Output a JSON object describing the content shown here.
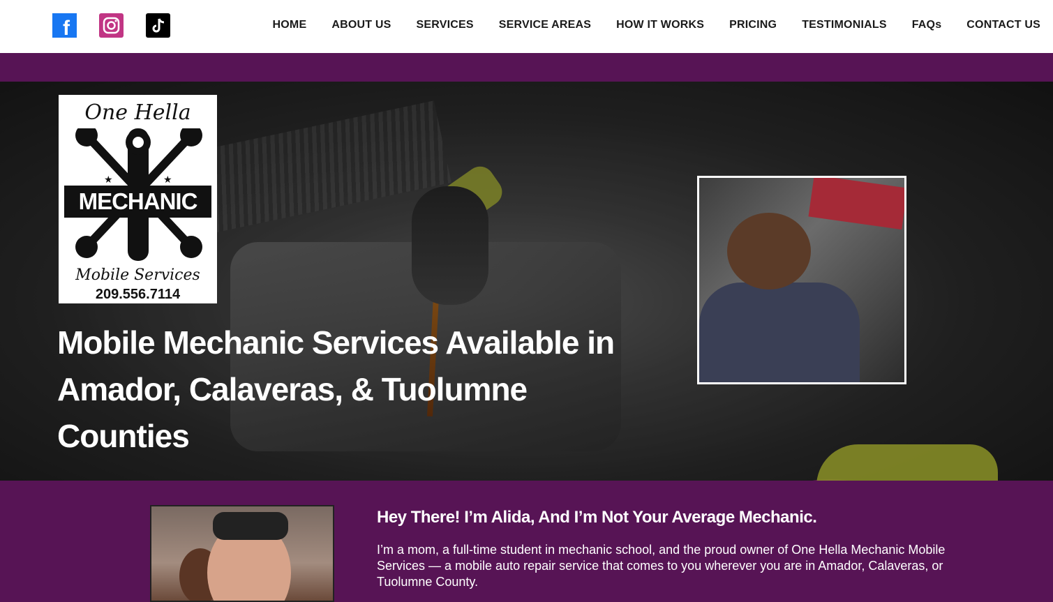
{
  "social": {
    "facebook": "f",
    "instagram": "◎",
    "tiktok": "♪"
  },
  "nav": {
    "items": [
      "HOME",
      "ABOUT US",
      "SERVICES",
      "SERVICE AREAS",
      "HOW IT WORKS",
      "PRICING",
      "TESTIMONIALS",
      "FAQs",
      "CONTACT US"
    ]
  },
  "logo": {
    "line1": "One Hella",
    "ribbon": "MECHANIC",
    "line3": "Mobile Services",
    "phone": "209.556.7114"
  },
  "hero": {
    "title": "Mobile Mechanic Services Available in Amador, Calaveras, & Tuolumne Counties"
  },
  "about": {
    "heading": "Hey There! I’m Alida, And I’m Not Your Average Mechanic.",
    "body": "I’m a mom, a full-time student in mechanic school, and the proud owner of One Hella Mechanic Mobile Services — a mobile auto repair service that comes to you wherever you are in Amador, Calaveras, or Tuolumne County."
  },
  "colors": {
    "brand_purple": "#571455",
    "facebook": "#1877f2",
    "instagram": "#c13584",
    "tiktok": "#000000"
  }
}
